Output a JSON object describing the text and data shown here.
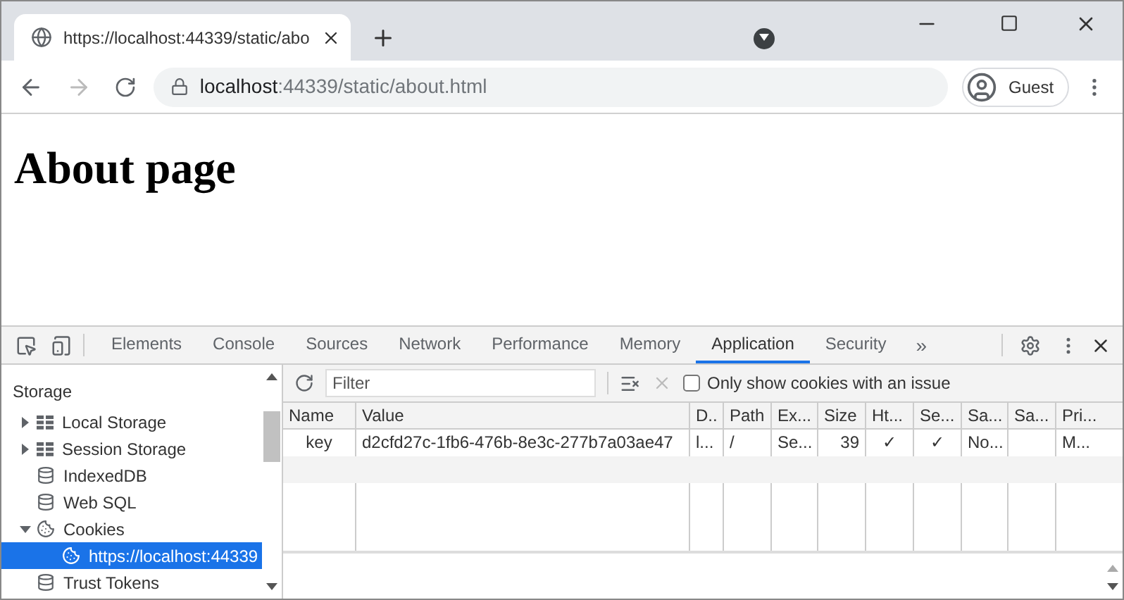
{
  "browser": {
    "tab_title": "https://localhost:44339/static/abo",
    "url_host": "localhost",
    "url_rest": ":44339/static/about.html",
    "profile": "Guest"
  },
  "page": {
    "heading": "About page"
  },
  "devtools": {
    "tabs": [
      {
        "label": "Elements",
        "selected": false
      },
      {
        "label": "Console",
        "selected": false
      },
      {
        "label": "Sources",
        "selected": false
      },
      {
        "label": "Network",
        "selected": false
      },
      {
        "label": "Performance",
        "selected": false
      },
      {
        "label": "Memory",
        "selected": false
      },
      {
        "label": "Application",
        "selected": true
      },
      {
        "label": "Security",
        "selected": false
      }
    ],
    "more_tabs": "»",
    "sidebar": {
      "section": "Storage",
      "items": [
        {
          "label": "Local Storage",
          "kind": "grid",
          "expanded": false,
          "selected": false
        },
        {
          "label": "Session Storage",
          "kind": "grid",
          "expanded": false,
          "selected": false
        },
        {
          "label": "IndexedDB",
          "kind": "database",
          "selected": false
        },
        {
          "label": "Web SQL",
          "kind": "database",
          "selected": false
        },
        {
          "label": "Cookies",
          "kind": "cookie",
          "expanded": true,
          "selected": false,
          "children": [
            {
              "label": "https://localhost:44339",
              "kind": "cookie",
              "selected": true
            }
          ]
        },
        {
          "label": "Trust Tokens",
          "kind": "database",
          "selected": false
        }
      ]
    },
    "filter": {
      "placeholder": "Filter"
    },
    "issue_only": {
      "label": "Only show cookies with an issue",
      "checked": false
    },
    "table": {
      "columns": [
        "Name",
        "Value",
        "D..",
        "Path",
        "Ex...",
        "Size",
        "Ht...",
        "Se...",
        "Sa...",
        "Sa...",
        "Pri..."
      ],
      "rows": [
        [
          "key",
          "d2cfd27c-1fb6-476b-8e3c-277b7a03ae47",
          "l...",
          "/",
          "Se...",
          "39",
          "✓",
          "✓",
          "No...",
          "",
          "M..."
        ]
      ]
    }
  }
}
